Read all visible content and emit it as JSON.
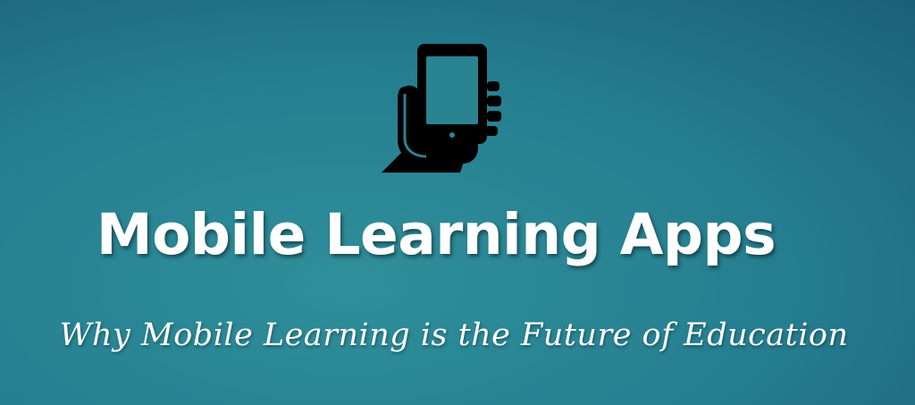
{
  "banner": {
    "title": "Mobile Learning Apps",
    "subtitle": "Why Mobile Learning is the Future of Education",
    "icon": "hand-holding-phone-icon",
    "colors": {
      "background_light": "#2f8f9a",
      "background_dark": "#124a68",
      "icon": "#000000",
      "text": "#ffffff"
    }
  }
}
